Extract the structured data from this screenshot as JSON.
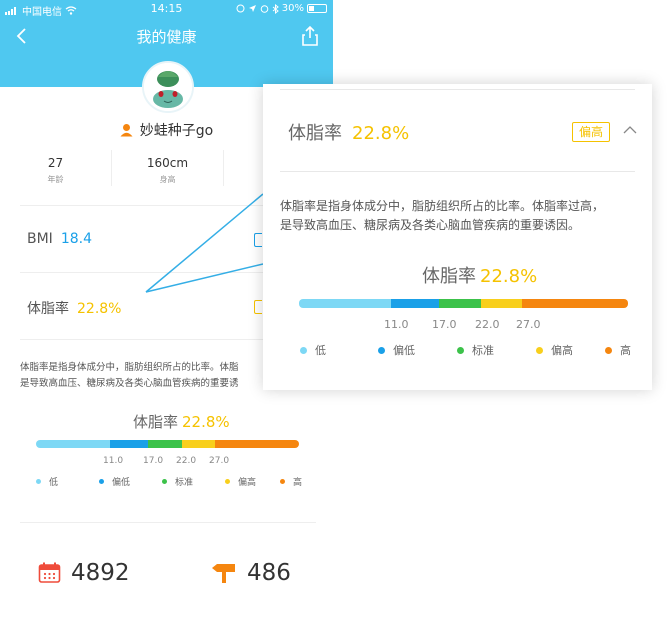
{
  "status_bar": {
    "carrier": "中国电信",
    "time": "14:15",
    "battery": "30%"
  },
  "nav": {
    "title": "我的健康"
  },
  "profile": {
    "username": "妙蛙种子go"
  },
  "stats": [
    {
      "value": "27",
      "label": "年龄"
    },
    {
      "value": "160cm",
      "label": "身高"
    }
  ],
  "bmi": {
    "label": "BMI",
    "value": "18.4"
  },
  "body_fat": {
    "label": "体脂率",
    "value": "22.8%",
    "level": "偏高",
    "description_line1": "体脂率是指身体成分中，脂肪组织所占的比率。体脂率过高，",
    "description_line2": "是导致高血压、糖尿病及各类心脑血管疾病的重要诱因。",
    "small_description_line1": "体脂率是指身体成分中，脂肪组织所占的比率。体脂",
    "small_description_line2": "是导致高血压、糖尿病及各类心脑血管疾病的重要诱",
    "scale_title": "体脂率",
    "ticks": [
      "11.0",
      "17.0",
      "22.0",
      "27.0"
    ],
    "legend": [
      {
        "label": "低",
        "color": "#7dd8f5"
      },
      {
        "label": "偏低",
        "color": "#1aa0e8"
      },
      {
        "label": "标准",
        "color": "#3cc24a"
      },
      {
        "label": "偏高",
        "color": "#f8cf1c"
      },
      {
        "label": "高",
        "color": "#f5860f"
      }
    ]
  },
  "bottom": {
    "steps": "4892",
    "distance": "486"
  },
  "colors": {
    "accent": "#4fc8f0",
    "highlight": "#f5c200"
  }
}
